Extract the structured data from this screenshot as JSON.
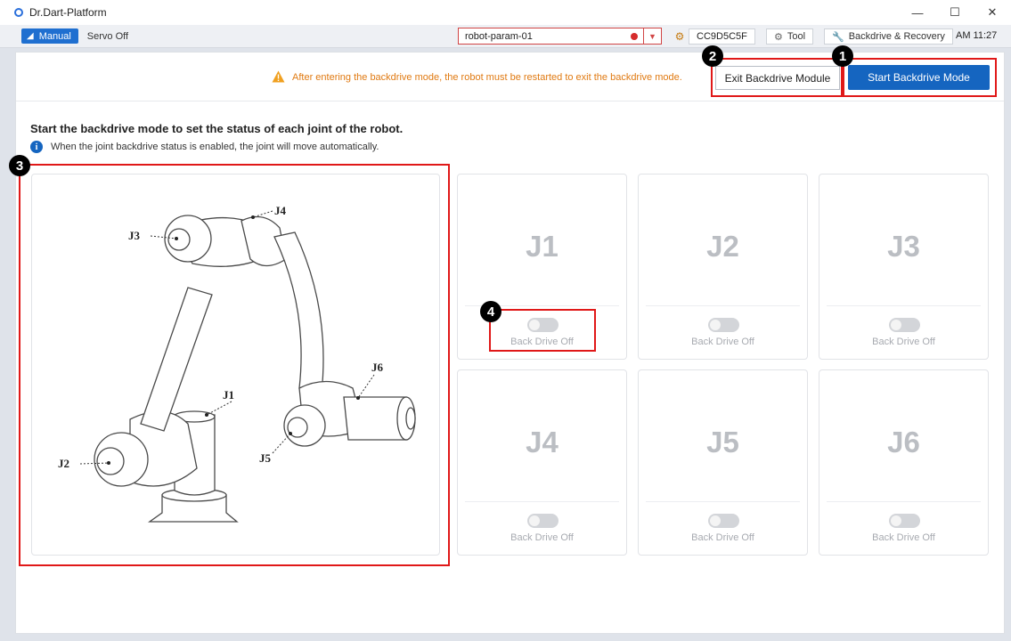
{
  "window": {
    "title": "Dr.Dart-Platform",
    "controls": {
      "minimize": "—",
      "maximize": "☐",
      "close": "✕"
    }
  },
  "toolbar": {
    "mode_label": "Manual",
    "mode_icon": "robot-arm-icon",
    "servo_status": "Servo Off",
    "param_file": "robot-param-01",
    "param_status_color": "#d62c2c",
    "serial": "CC9D5C5F",
    "tool_label": "Tool",
    "backdrive_label": "Backdrive & Recovery",
    "time": "AM 11:27"
  },
  "notice": {
    "text": "After entering the backdrive mode, the robot must be restarted to exit the backdrive mode.",
    "color": "#e07a12"
  },
  "actions": {
    "exit_label": "Exit Backdrive Module",
    "start_label": "Start Backdrive Mode"
  },
  "main": {
    "heading": "Start the backdrive mode to set the status of each joint of the robot.",
    "info": "When the joint backdrive status is enabled, the joint will move automatically."
  },
  "diagram": {
    "labels": [
      "J1",
      "J2",
      "J3",
      "J4",
      "J5",
      "J6"
    ]
  },
  "joints": [
    {
      "name": "J1",
      "status": "Back Drive Off",
      "enabled": false
    },
    {
      "name": "J2",
      "status": "Back Drive Off",
      "enabled": false
    },
    {
      "name": "J3",
      "status": "Back Drive Off",
      "enabled": false
    },
    {
      "name": "J4",
      "status": "Back Drive Off",
      "enabled": false
    },
    {
      "name": "J5",
      "status": "Back Drive Off",
      "enabled": false
    },
    {
      "name": "J6",
      "status": "Back Drive Off",
      "enabled": false
    }
  ],
  "annotations": [
    "1",
    "2",
    "3",
    "4"
  ],
  "colors": {
    "accent": "#1565c0",
    "callout": "#e01818"
  }
}
